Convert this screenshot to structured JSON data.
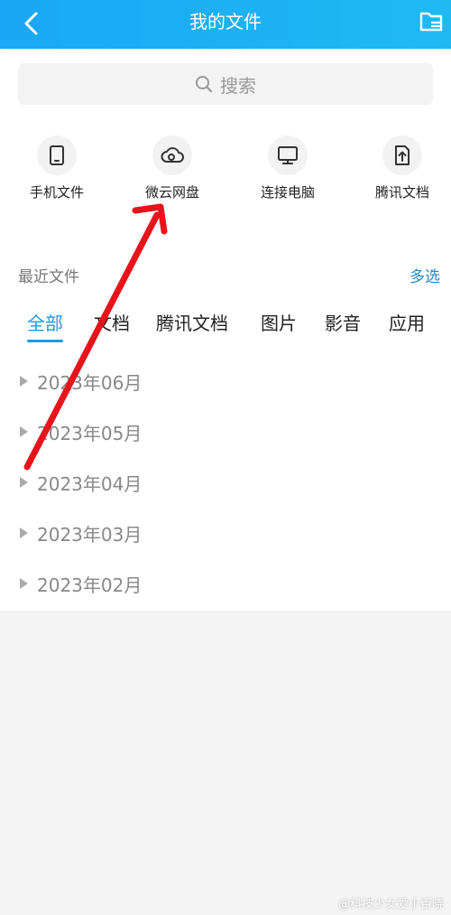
{
  "header": {
    "title": "我的文件",
    "back_icon": "chevron-left-icon",
    "folder_icon": "folder-settings-icon"
  },
  "search": {
    "placeholder": "搜索",
    "icon": "search-icon"
  },
  "shortcuts": [
    {
      "label": "手机文件",
      "icon": "phone-icon"
    },
    {
      "label": "微云网盘",
      "icon": "cloud-icon"
    },
    {
      "label": "连接电脑",
      "icon": "monitor-icon"
    },
    {
      "label": "腾讯文档",
      "icon": "doc-upload-icon"
    }
  ],
  "recent": {
    "label": "最近文件",
    "multi_select": "多选"
  },
  "tabs": [
    {
      "label": "全部",
      "active": true
    },
    {
      "label": "文档",
      "active": false
    },
    {
      "label": "腾讯文档",
      "active": false
    },
    {
      "label": "图片",
      "active": false
    },
    {
      "label": "影音",
      "active": false
    },
    {
      "label": "应用",
      "active": false
    }
  ],
  "months": [
    {
      "label": "2023年06月"
    },
    {
      "label": "2023年05月"
    },
    {
      "label": "2023年04月"
    },
    {
      "label": "2023年03月"
    },
    {
      "label": "2023年02月"
    }
  ],
  "watermark": "@科技少女爱小百晓",
  "colors": {
    "header": "#1aa7f5",
    "accent": "#1e9be0",
    "link": "#2b87c9",
    "annotation_arrow": "#e8131b"
  }
}
